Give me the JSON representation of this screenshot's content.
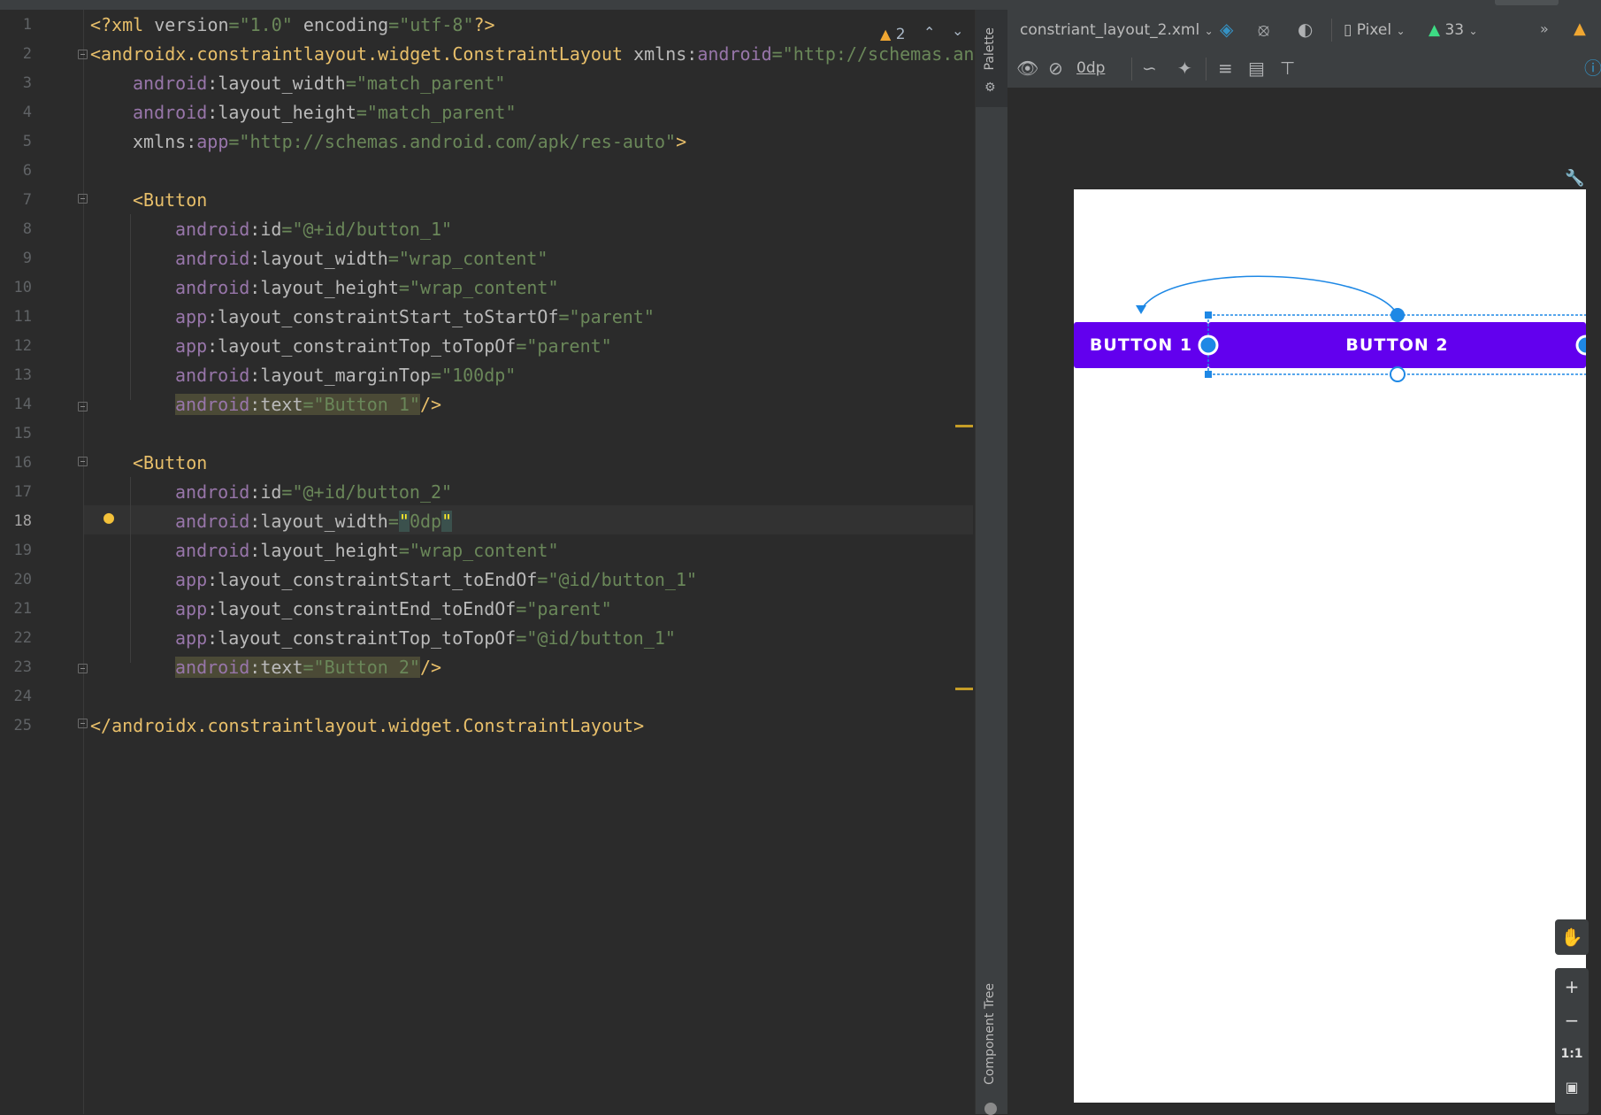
{
  "editor": {
    "line_numbers": [
      "1",
      "2",
      "3",
      "4",
      "5",
      "6",
      "7",
      "8",
      "9",
      "10",
      "11",
      "12",
      "13",
      "14",
      "15",
      "16",
      "17",
      "18",
      "19",
      "20",
      "21",
      "22",
      "23",
      "24",
      "25"
    ],
    "current_line": "18",
    "warnings_count": "2",
    "lines": {
      "l1": {
        "a": "<?xml ",
        "b": "version",
        "c": "=\"1.0\" ",
        "d": "encoding",
        "e": "=\"utf-8\"",
        "f": "?>"
      },
      "l2": {
        "a": "<androidx.constraintlayout.widget.ConstraintLayout ",
        "b": "xmlns:",
        "c": "android",
        "d": "=\"http://schemas.and"
      },
      "l3": {
        "ns": "android",
        "attr": ":layout_width",
        "val": "=\"match_parent\""
      },
      "l4": {
        "ns": "android",
        "attr": ":layout_height",
        "val": "=\"match_parent\""
      },
      "l5": {
        "attr": "xmlns:",
        "ns": "app",
        "val": "=\"http://schemas.android.com/apk/res-auto\"",
        "end": ">"
      },
      "l7": {
        "tag": "<Button"
      },
      "l8": {
        "ns": "android",
        "attr": ":id",
        "val": "=\"@+id/button_1\""
      },
      "l9": {
        "ns": "android",
        "attr": ":layout_width",
        "val": "=\"wrap_content\""
      },
      "l10": {
        "ns": "android",
        "attr": ":layout_height",
        "val": "=\"wrap_content\""
      },
      "l11": {
        "ns": "app",
        "attr": ":layout_constraintStart_toStartOf",
        "val": "=\"parent\""
      },
      "l12": {
        "ns": "app",
        "attr": ":layout_constraintTop_toTopOf",
        "val": "=\"parent\""
      },
      "l13": {
        "ns": "android",
        "attr": ":layout_marginTop",
        "val": "=\"100dp\""
      },
      "l14": {
        "ns": "android",
        "attr": ":text",
        "val": "=\"Button 1\"",
        "end": "/>"
      },
      "l16": {
        "tag": "<Button"
      },
      "l17": {
        "ns": "android",
        "attr": ":id",
        "val": "=\"@+id/button_2\""
      },
      "l18": {
        "ns": "android",
        "attr": ":layout_width",
        "eq": "=",
        "q1": "\"",
        "val": "0dp",
        "q2": "\""
      },
      "l19": {
        "ns": "android",
        "attr": ":layout_height",
        "val": "=\"wrap_content\""
      },
      "l20": {
        "ns": "app",
        "attr": ":layout_constraintStart_toEndOf",
        "val": "=\"@id/button_1\""
      },
      "l21": {
        "ns": "app",
        "attr": ":layout_constraintEnd_toEndOf",
        "val": "=\"parent\""
      },
      "l22": {
        "ns": "app",
        "attr": ":layout_constraintTop_toTopOf",
        "val": "=\"@id/button_1\""
      },
      "l23": {
        "ns": "android",
        "attr": ":text",
        "val": "=\"Button 2\"",
        "end": "/>"
      },
      "l25": {
        "tag": "</androidx.constraintlayout.widget.ConstraintLayout>"
      }
    }
  },
  "sidebar": {
    "palette_label": "Palette",
    "component_tree_label": "Component Tree"
  },
  "design_toolbar": {
    "file_name": "constriant_layout_2.xml",
    "device": "Pixel",
    "api_level": "33",
    "default_margin": "0dp"
  },
  "preview": {
    "button_1_text": "BUTTON 1",
    "button_2_text": "BUTTON 2"
  },
  "zoom": {
    "zoom_in": "+",
    "zoom_out": "−",
    "actual_size": "1:1"
  },
  "colors": {
    "button": "#6200ee",
    "constraint_blue": "#1e88e5",
    "warning": "#f0a732"
  }
}
